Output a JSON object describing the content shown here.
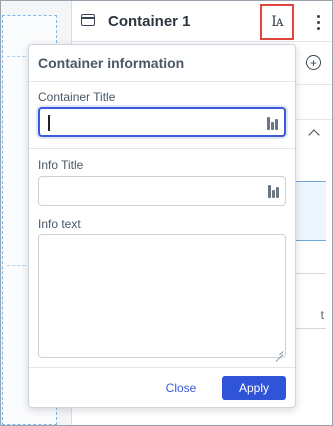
{
  "panel": {
    "title": "Container 1"
  },
  "popover": {
    "title": "Container information",
    "container_title": {
      "label": "Container Title",
      "value": ""
    },
    "info_title": {
      "label": "Info Title",
      "value": ""
    },
    "info_text": {
      "label": "Info text",
      "value": ""
    },
    "close_label": "Close",
    "apply_label": "Apply"
  },
  "background": {
    "partial_text": "t"
  },
  "colors": {
    "accent": "#2f54d8",
    "highlight_outline": "#e0463d"
  }
}
